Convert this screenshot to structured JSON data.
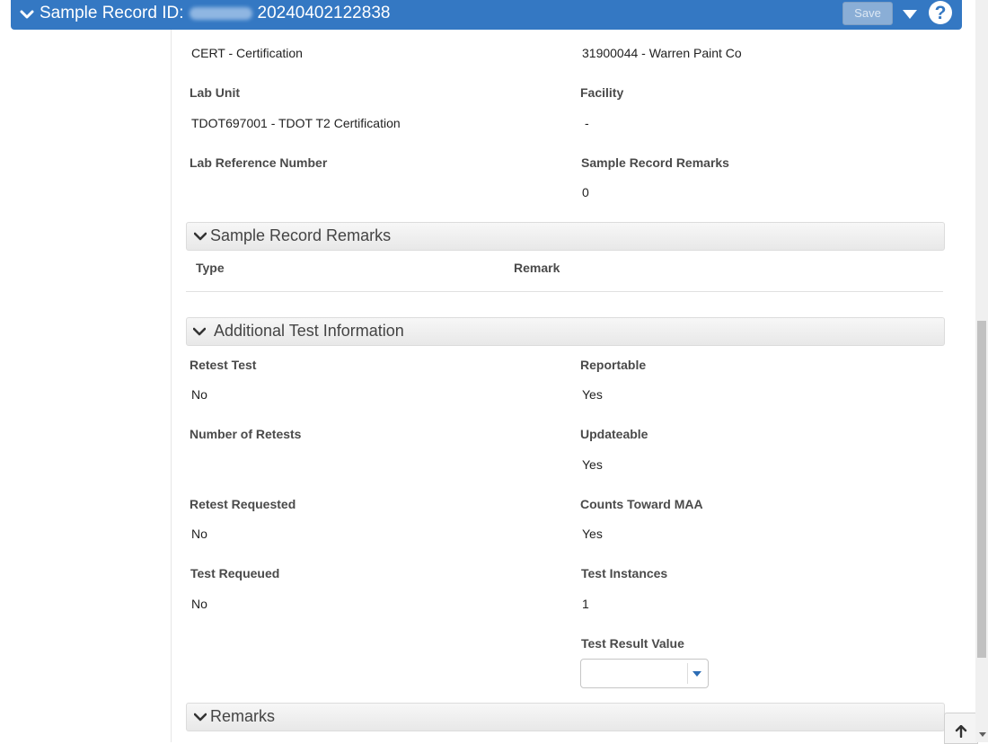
{
  "header": {
    "title_prefix": "Sample Record ID:",
    "record_id": "20240402122838",
    "save_label": "Save",
    "help_symbol": "?"
  },
  "top_fields": {
    "left_value": "CERT - Certification",
    "right_value": "31900044 - Warren Paint Co"
  },
  "fields": {
    "lab_unit_label": "Lab Unit",
    "lab_unit_value": "TDOT697001 - TDOT T2 Certification",
    "facility_label": "Facility",
    "facility_value": "-",
    "lab_ref_label": "Lab Reference Number",
    "remarks_count_label": "Sample Record Remarks",
    "remarks_count_value": "0"
  },
  "remarks_section": {
    "title": "Sample Record Remarks",
    "columns": [
      "Type",
      "Remark"
    ]
  },
  "additional_section": {
    "title": "Additional Test Information",
    "retest_test_label": "Retest Test",
    "retest_test_value": "No",
    "reportable_label": "Reportable",
    "reportable_value": "Yes",
    "num_retests_label": "Number of Retests",
    "updateable_label": "Updateable",
    "updateable_value": "Yes",
    "retest_requested_label": "Retest Requested",
    "retest_requested_value": "No",
    "counts_maa_label": "Counts Toward MAA",
    "counts_maa_value": "Yes",
    "test_requeued_label": "Test Requeued",
    "test_requeued_value": "No",
    "test_instances_label": "Test Instances",
    "test_instances_value": "1",
    "test_result_label": "Test Result Value"
  },
  "remarks_bottom": {
    "title": "Remarks"
  },
  "icons": {
    "header_chevron": "chevron-down-icon",
    "header_caret": "caret-down-icon",
    "help": "help-icon",
    "back_to_top": "arrow-up-icon"
  },
  "colors": {
    "header_bg": "#3478c3",
    "save_disabled": "#8aaed6",
    "select_arrow": "#2c6db5"
  }
}
